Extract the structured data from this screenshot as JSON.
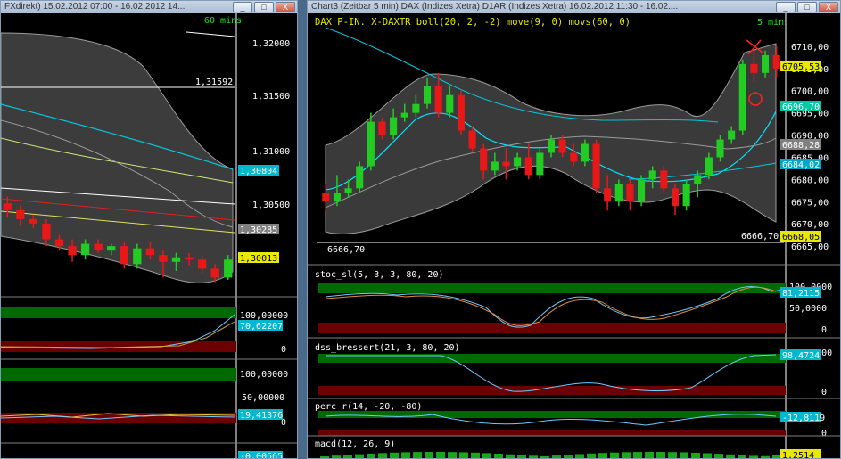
{
  "left_window": {
    "title": "FXdirekt) 15.02.2012 07:00 - 16.02.2012 14...",
    "timeframe": "60 mins",
    "buttons": [
      "_",
      "□",
      "X"
    ],
    "price_axis": [
      "1,32000",
      "1,31500",
      "1,31000",
      "1,30500"
    ],
    "level_line_label": "1,31592",
    "tags": {
      "cyan": "1,30804",
      "gray": "1,30285",
      "yellow": "1,30013"
    },
    "panel1_axis": [
      "100,00000",
      "0"
    ],
    "panel1_tag": "70,62207",
    "panel2_axis": [
      "100,00000",
      "50,00000",
      "0"
    ],
    "panel2_tag": "19,41376",
    "panel3_tag": "-0,00565"
  },
  "right_window": {
    "title": "Chart3 (Zeitbar 5 min)  DAX (Indizes Xetra) D1AR (Indizes Xetra) 16.02.2012 11:30 - 16.02....",
    "timeframe": "5 mins",
    "buttons": [
      "_",
      "□",
      "X"
    ],
    "header_label": "DAX P-IN. X-DAXTR boll(20, 2, -2) move(9, 0) movs(60, 0)",
    "price_axis": [
      "6710,00",
      "6705,00",
      "6700,00",
      "6695,00",
      "6690,00",
      "6685,00",
      "6680,00",
      "6675,00",
      "6670,00",
      "6665,00"
    ],
    "tags": {
      "last": "6705,53",
      "upper_band": "6696,70",
      "move": "6688,28",
      "movs": "6684,02",
      "lower_band": "6668,05"
    },
    "low_line_left": "6666,70",
    "low_line_right": "6666,70",
    "stoc": {
      "label": "stoc_sl(5, 3, 3, 80, 20)",
      "axis": [
        "100,0000",
        "50,0000",
        "0"
      ],
      "tag": "81,2115"
    },
    "dss": {
      "label": "dss_bressert(21, 3, 80, 20)",
      "axis": [
        "100,0000",
        "0"
      ],
      "tag": "98,4724"
    },
    "perc": {
      "label": "perc_r(14, -20, -80)",
      "axis": [
        "0"
      ],
      "tag": "-12,8119"
    },
    "macd": {
      "label": "macd(12, 26, 9)",
      "tag": "1,2514"
    }
  },
  "colors": {
    "up": "#22cc22",
    "down": "#e81818",
    "band": "#3a3a3a",
    "mid": "#00e5ff",
    "gray_ma": "#9a9a9a",
    "zone_green": "#006a00",
    "zone_red": "#6a0000"
  },
  "chart_data": [
    {
      "type": "candlestick",
      "title": "DAX 5 min",
      "ylim": [
        6662,
        6713
      ],
      "ohlc": [
        [
          6677,
          6679,
          6673,
          6675
        ],
        [
          6675,
          6681,
          6674,
          6677
        ],
        [
          6677,
          6680,
          6676,
          6678
        ],
        [
          6678,
          6684,
          6677,
          6683
        ],
        [
          6683,
          6695,
          6682,
          6693
        ],
        [
          6693,
          6694,
          6689,
          6690
        ],
        [
          6690,
          6696,
          6689,
          6694
        ],
        [
          6694,
          6697,
          6693,
          6695
        ],
        [
          6695,
          6699,
          6694,
          6697
        ],
        [
          6697,
          6703,
          6696,
          6701
        ],
        [
          6701,
          6704,
          6694,
          6695
        ],
        [
          6695,
          6701,
          6694,
          6699
        ],
        [
          6699,
          6700,
          6690,
          6691
        ],
        [
          6691,
          6692,
          6686,
          6687
        ],
        [
          6687,
          6688,
          6680,
          6682
        ],
        [
          6682,
          6686,
          6681,
          6684
        ],
        [
          6684,
          6687,
          6680,
          6683
        ],
        [
          6683,
          6686,
          6682,
          6685
        ],
        [
          6685,
          6688,
          6680,
          6681
        ],
        [
          6681,
          6687,
          6680,
          6686
        ],
        [
          6686,
          6690,
          6685,
          6689
        ],
        [
          6689,
          6690,
          6685,
          6686
        ],
        [
          6686,
          6688,
          6683,
          6684
        ],
        [
          6684,
          6689,
          6683,
          6688
        ],
        [
          6688,
          6689,
          6677,
          6678
        ],
        [
          6678,
          6681,
          6673,
          6675
        ],
        [
          6675,
          6680,
          6674,
          6679
        ],
        [
          6679,
          6680,
          6673,
          6675
        ],
        [
          6675,
          6681,
          6674,
          6680
        ],
        [
          6680,
          6683,
          6678,
          6682
        ],
        [
          6682,
          6683,
          6677,
          6678
        ],
        [
          6678,
          6679,
          6672,
          6674
        ],
        [
          6674,
          6680,
          6673,
          6679
        ],
        [
          6679,
          6682,
          6676,
          6681
        ],
        [
          6681,
          6686,
          6680,
          6685
        ],
        [
          6685,
          6690,
          6684,
          6689
        ],
        [
          6689,
          6692,
          6688,
          6691
        ],
        [
          6691,
          6707,
          6690,
          6706
        ],
        [
          6706,
          6710,
          6702,
          6704
        ],
        [
          6704,
          6709,
          6703,
          6708
        ],
        [
          6708,
          6710,
          6703,
          6705
        ]
      ]
    },
    {
      "type": "candlestick",
      "title": "FX 60 min",
      "ylim": [
        1.299,
        1.322
      ],
      "ohlc": [
        [
          1.3062,
          1.3068,
          1.305,
          1.3056
        ],
        [
          1.3056,
          1.306,
          1.3042,
          1.3048
        ],
        [
          1.3048,
          1.3052,
          1.304,
          1.3044
        ],
        [
          1.3044,
          1.3048,
          1.3024,
          1.303
        ],
        [
          1.303,
          1.3034,
          1.302,
          1.3024
        ],
        [
          1.3024,
          1.303,
          1.301,
          1.3016
        ],
        [
          1.3016,
          1.303,
          1.3012,
          1.3026
        ],
        [
          1.3026,
          1.303,
          1.3018,
          1.302
        ],
        [
          1.302,
          1.3026,
          1.3016,
          1.3024
        ],
        [
          1.3024,
          1.3028,
          1.3004,
          1.3008
        ],
        [
          1.3008,
          1.3026,
          1.3004,
          1.3022
        ],
        [
          1.3022,
          1.3028,
          1.3012,
          1.3016
        ],
        [
          1.3016,
          1.302,
          1.2996,
          1.301
        ],
        [
          1.301,
          1.3018,
          1.3002,
          1.3014
        ],
        [
          1.3014,
          1.3018,
          1.3006,
          1.3012
        ],
        [
          1.3012,
          1.3016,
          1.3,
          1.3004
        ],
        [
          1.3004,
          1.3008,
          1.2992,
          1.2996
        ],
        [
          1.2996,
          1.3016,
          1.2994,
          1.3012
        ]
      ]
    }
  ]
}
